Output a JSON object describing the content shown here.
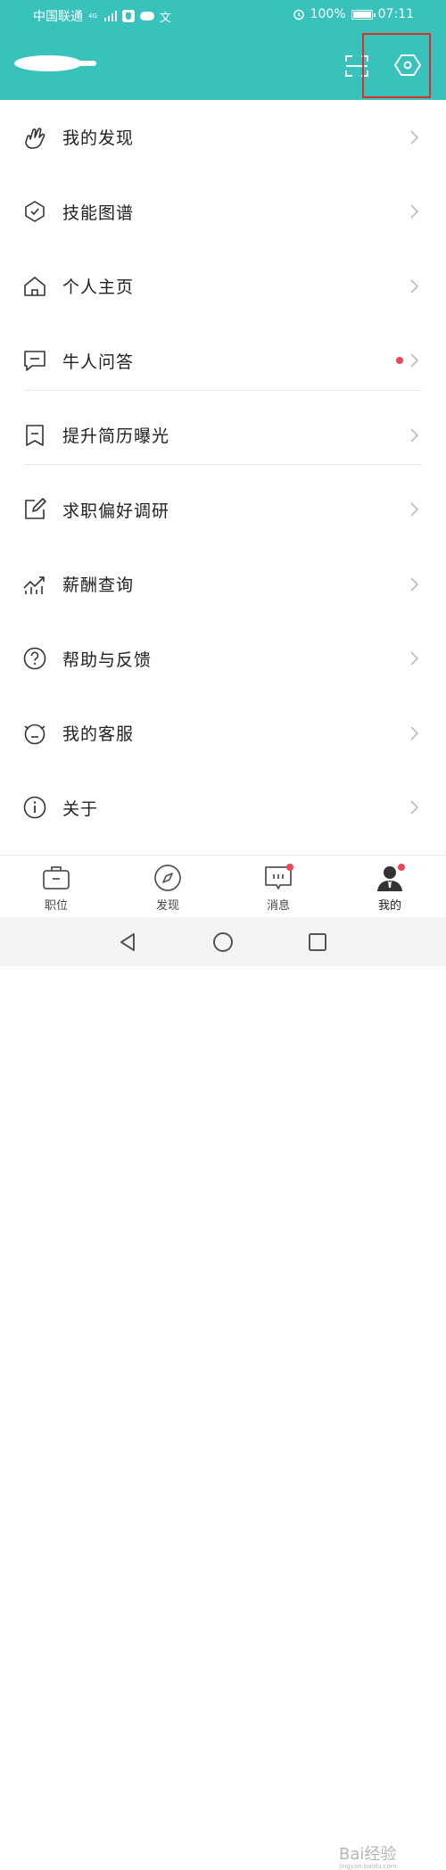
{
  "status_bar": {
    "carrier": "中国联通",
    "network": "4G",
    "battery": "100%",
    "time": "07:11"
  },
  "header": {
    "accent_color": "#37c2bc",
    "scan_icon": "scan-icon",
    "settings_icon": "hexagon-settings-icon"
  },
  "menu": {
    "items": [
      {
        "label": "我的发现",
        "icon": "finger-heart-icon"
      },
      {
        "label": "技能图谱",
        "icon": "shield-check-icon"
      },
      {
        "label": "个人主页",
        "icon": "home-icon"
      },
      {
        "label": "牛人问答",
        "icon": "chat-icon",
        "has_dot": true
      },
      {
        "label": "提升简历曝光",
        "icon": "bookmark-icon"
      },
      {
        "label": "求职偏好调研",
        "icon": "edit-icon"
      },
      {
        "label": "薪酬查询",
        "icon": "trend-chart-icon"
      },
      {
        "label": "帮助与反馈",
        "icon": "question-icon"
      },
      {
        "label": "我的客服",
        "icon": "service-face-icon"
      },
      {
        "label": "关于",
        "icon": "info-icon"
      }
    ]
  },
  "tabs": [
    {
      "label": "职位",
      "icon": "briefcase-icon"
    },
    {
      "label": "发现",
      "icon": "compass-icon"
    },
    {
      "label": "消息",
      "icon": "message-icon",
      "has_dot": true
    },
    {
      "label": "我的",
      "icon": "user-icon",
      "has_dot": true,
      "active": true
    }
  ],
  "watermark": {
    "text": "Bai经验",
    "sub": "jingyan.baidu.com"
  }
}
